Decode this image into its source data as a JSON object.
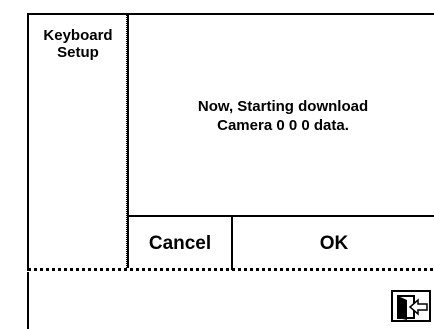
{
  "sidebar": {
    "title_line1": "Keyboard",
    "title_line2": "Setup"
  },
  "dialog": {
    "message_line1": "Now, Starting download",
    "message_line2": "Camera 0 0 0 data.",
    "cancel_label": "Cancel",
    "ok_label": "OK"
  },
  "bottom_bar": {
    "exit_icon": "exit-door-icon"
  }
}
